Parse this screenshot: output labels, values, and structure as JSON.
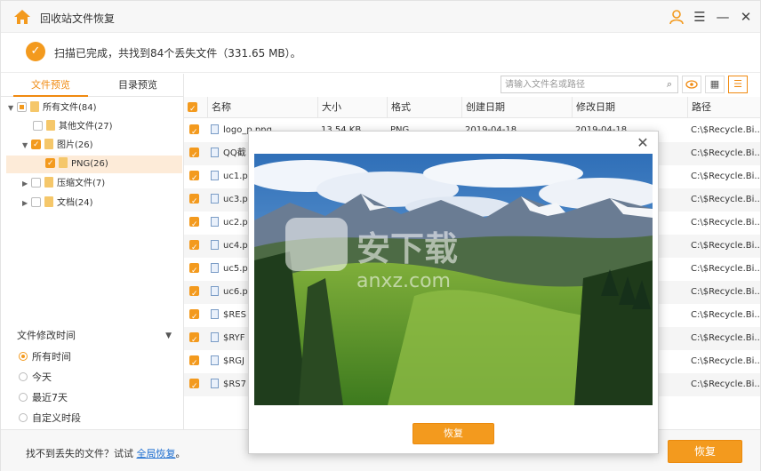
{
  "window": {
    "title": "回收站文件恢复"
  },
  "status": {
    "message": "扫描已完成，共找到84个丢失文件（331.65 MB）。"
  },
  "tabs": {
    "file_preview": "文件预览",
    "dir_preview": "目录预览"
  },
  "tree": {
    "all": "所有文件(84)",
    "other": "其他文件(27)",
    "images": "图片(26)",
    "png": "PNG(26)",
    "archives": "压缩文件(7)",
    "docs": "文档(24)"
  },
  "filter": {
    "title": "文件修改时间",
    "options": [
      "所有时间",
      "今天",
      "最近7天",
      "自定义时段"
    ]
  },
  "search": {
    "placeholder": "请输入文件名或路径"
  },
  "table": {
    "headers": [
      "名称",
      "大小",
      "格式",
      "创建日期",
      "修改日期",
      "路径"
    ],
    "rows": [
      {
        "name": "logo_p.png",
        "size": "13.54 KB",
        "format": "PNG",
        "created": "2019-04-18",
        "modified": "2019-04-18",
        "path": "C:\\$Recycle.Bi..."
      },
      {
        "name": "QQ截",
        "path": "C:\\$Recycle.Bi..."
      },
      {
        "name": "uc1.p",
        "path": "C:\\$Recycle.Bi..."
      },
      {
        "name": "uc3.p",
        "path": "C:\\$Recycle.Bi..."
      },
      {
        "name": "uc2.p",
        "path": "C:\\$Recycle.Bi..."
      },
      {
        "name": "uc4.p",
        "path": "C:\\$Recycle.Bi..."
      },
      {
        "name": "uc5.p",
        "path": "C:\\$Recycle.Bi..."
      },
      {
        "name": "uc6.p",
        "path": "C:\\$Recycle.Bi..."
      },
      {
        "name": "$RES",
        "path": "C:\\$Recycle.Bi..."
      },
      {
        "name": "$RYF",
        "path": "C:\\$Recycle.Bi..."
      },
      {
        "name": "$RGJ",
        "path": "C:\\$Recycle.Bi..."
      },
      {
        "name": "$RS7",
        "path": "C:\\$Recycle.Bi..."
      }
    ]
  },
  "bottom": {
    "hint": "找不到丢失的文件？试试",
    "link": "全局恢复",
    "hint_end": "。",
    "recover": "恢复"
  },
  "modal": {
    "recover": "恢复",
    "watermark_cn": "安下载",
    "watermark_en": "anxz.com"
  },
  "colors": {
    "accent": "#f39a1e"
  }
}
